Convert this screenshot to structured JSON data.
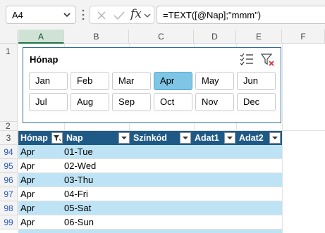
{
  "formula_bar": {
    "name_box": "A4",
    "fx_symbol": "fx",
    "formula": "=TEXT([@Nap];\"mmm\")"
  },
  "columns": [
    "A",
    "B",
    "C",
    "D",
    "E",
    "F"
  ],
  "selected_column": "A",
  "rows": {
    "r1": "1",
    "r2": "2",
    "r3": "3",
    "filtered": [
      "94",
      "95",
      "96",
      "97",
      "98",
      "99"
    ]
  },
  "slicer": {
    "title": "Hónap",
    "items": [
      "Jan",
      "Feb",
      "Mar",
      "Apr",
      "May",
      "Jun",
      "Jul",
      "Aug",
      "Sep",
      "Oct",
      "Nov",
      "Dec"
    ],
    "selected": "Apr"
  },
  "table": {
    "headers": [
      "Hónap",
      "Nap",
      "Színkód",
      "Adat1",
      "Adat2"
    ],
    "rows": [
      [
        "Apr",
        "01-Tue",
        "",
        "",
        ""
      ],
      [
        "Apr",
        "02-Wed",
        "",
        "",
        ""
      ],
      [
        "Apr",
        "03-Thu",
        "",
        "",
        ""
      ],
      [
        "Apr",
        "04-Fri",
        "",
        "",
        ""
      ],
      [
        "Apr",
        "05-Sat",
        "",
        "",
        ""
      ],
      [
        "Apr",
        "06-Sun",
        "",
        "",
        ""
      ]
    ]
  },
  "colors": {
    "header_bg": "#1f5a87",
    "band_bg": "#bde3f4",
    "slicer_selected": "#7fc5e6",
    "filtered_row_number": "#2a55c4"
  },
  "icons": {
    "name_box_dropdown": "chevron-down-icon",
    "cancel": "x-icon",
    "enter": "check-icon",
    "insert_function": "fx-icon",
    "multi_select": "multiselect-icon",
    "clear_filter": "clear-filter-icon",
    "column_filter": "filter-dropdown-icon"
  }
}
